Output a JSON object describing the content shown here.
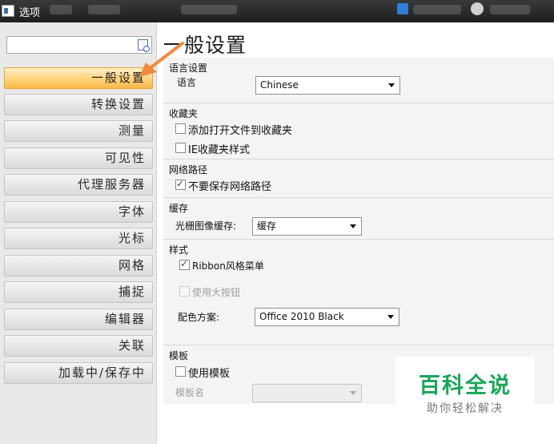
{
  "window": {
    "title": "选项"
  },
  "search": {
    "placeholder": ""
  },
  "nav": {
    "items": [
      "一般设置",
      "转换设置",
      "测量",
      "可见性",
      "代理服务器",
      "字体",
      "光标",
      "网格",
      "捕捉",
      "编辑器",
      "关联",
      "加载中/保存中"
    ],
    "active_index": 0
  },
  "page_title": "一般设置",
  "settings": {
    "language": {
      "group": "语言设置",
      "label": "语言",
      "value": "Chinese"
    },
    "favorites": {
      "group": "收藏夹",
      "add_open_file": {
        "label": "添加打开文件到收藏夹",
        "checked": false
      },
      "ie_style": {
        "label": "IE收藏夹样式",
        "checked": false
      }
    },
    "network_path": {
      "group": "网络路径",
      "dont_save": {
        "label": "不要保存网络路径",
        "checked": true
      }
    },
    "cache": {
      "group": "缓存",
      "label": "光栅图像缓存:",
      "value": "缓存"
    },
    "style": {
      "group": "样式",
      "ribbon": {
        "label": "Ribbon风格菜单",
        "checked": true
      },
      "big_buttons": {
        "label": "使用大按钮",
        "checked": false,
        "disabled": true
      },
      "color_scheme_label": "配色方案:",
      "color_scheme_value": "Office 2010 Black"
    },
    "template": {
      "group": "模板",
      "use_template": {
        "label": "使用模板",
        "checked": false
      },
      "name_label": "模板名",
      "name_value": ""
    }
  },
  "watermark": {
    "title": "百科全说",
    "subtitle": "助你轻松解决"
  },
  "colors": {
    "active_nav": "#ffd27a",
    "arrow": "#f08a3c",
    "watermark_green": "#1aa65a"
  }
}
